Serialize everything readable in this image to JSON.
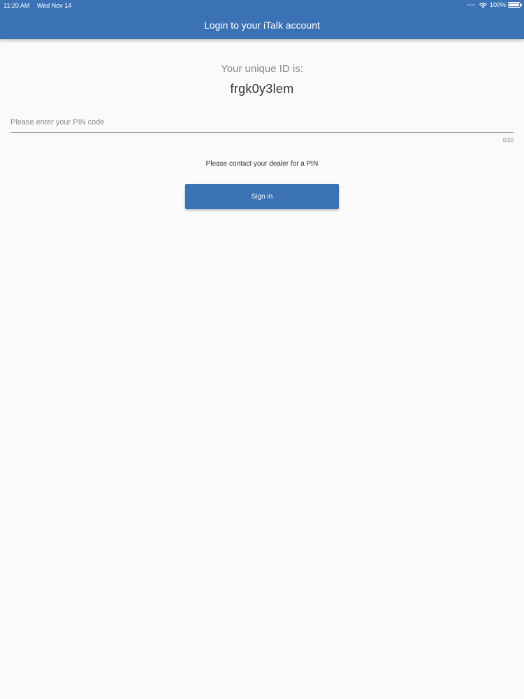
{
  "status_bar": {
    "time": "11:20 AM",
    "date": "Wed Nov 14",
    "battery_percent": "100%",
    "battery_level": 1.0,
    "icons": [
      "signal-dots-icon",
      "wifi-icon",
      "battery-icon"
    ]
  },
  "header": {
    "title": "Login to your iTalk account"
  },
  "account": {
    "id_label": "Your unique ID is:",
    "id_value": "frgk0y3lem"
  },
  "pin_field": {
    "placeholder": "Please enter your PIN code",
    "value": "",
    "counter": "0/20"
  },
  "help_text": "Please contact your dealer for a PIN",
  "sign_in_button": {
    "label": "Sign in"
  },
  "colors": {
    "primary": "#3b72b6",
    "background": "#fafafa",
    "muted_text": "#8a8a8a",
    "body_text": "#333333"
  }
}
